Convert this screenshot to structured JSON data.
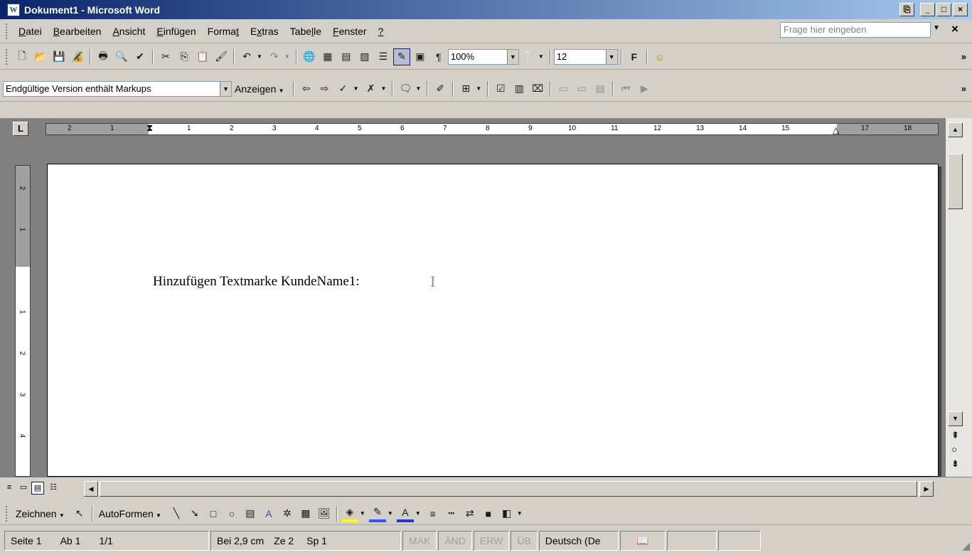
{
  "window": {
    "title": "Dokument1 - Microsoft Word",
    "app_icon": "W"
  },
  "menu": {
    "items": [
      {
        "label": "Datei",
        "accel": "D",
        "rest": "atei"
      },
      {
        "label": "Bearbeiten",
        "accel": "B",
        "rest": "earbeiten"
      },
      {
        "label": "Ansicht",
        "accel": "A",
        "rest": "nsicht"
      },
      {
        "label": "Einfügen",
        "accel": "E",
        "rest": "infügen"
      },
      {
        "label": "Format",
        "pre": "Forma",
        "accel": "t",
        "rest": ""
      },
      {
        "label": "Extras",
        "pre": "E",
        "accel": "x",
        "rest": "tras"
      },
      {
        "label": "Tabelle",
        "pre": "Tabe",
        "accel": "l",
        "rest": "le"
      },
      {
        "label": "Fenster",
        "accel": "F",
        "rest": "enster"
      },
      {
        "label": "?",
        "accel": "?",
        "rest": ""
      }
    ],
    "help_placeholder": "Frage hier eingeben",
    "doc_close": "×"
  },
  "standard_toolbar": {
    "zoom": "100%",
    "font_size": "12",
    "bold_label": "F"
  },
  "review_toolbar": {
    "display_mode": "Endgültige Version enthält Markups",
    "show_label": "Anzeigen"
  },
  "ruler": {
    "left_numbers": [
      "2",
      "1"
    ],
    "numbers": [
      "1",
      "2",
      "3",
      "4",
      "5",
      "6",
      "7",
      "8",
      "9",
      "10",
      "11",
      "12",
      "13",
      "14",
      "15",
      "17",
      "18"
    ]
  },
  "vertical_ruler": {
    "numbers": [
      "2",
      "1",
      "1",
      "2",
      "3",
      "4"
    ]
  },
  "document": {
    "text": "Hinzufügen Textmarke KundeName1:"
  },
  "drawing_toolbar": {
    "draw_label": "Zeichnen",
    "autoshapes_label": "AutoFormen"
  },
  "statusbar": {
    "page": "Seite 1",
    "section": "Ab 1",
    "pages": "1/1",
    "position": "Bei 2,9 cm",
    "line": "Ze 2",
    "column": "Sp 1",
    "mak": "MAK",
    "aend": "ÄND",
    "erw": "ERW",
    "ueb": "ÜB",
    "language": "Deutsch (De"
  },
  "colors": {
    "title_start": "#0a246a",
    "title_end": "#a6caf0",
    "chrome": "#d4d0c8",
    "workspace": "#808080"
  }
}
